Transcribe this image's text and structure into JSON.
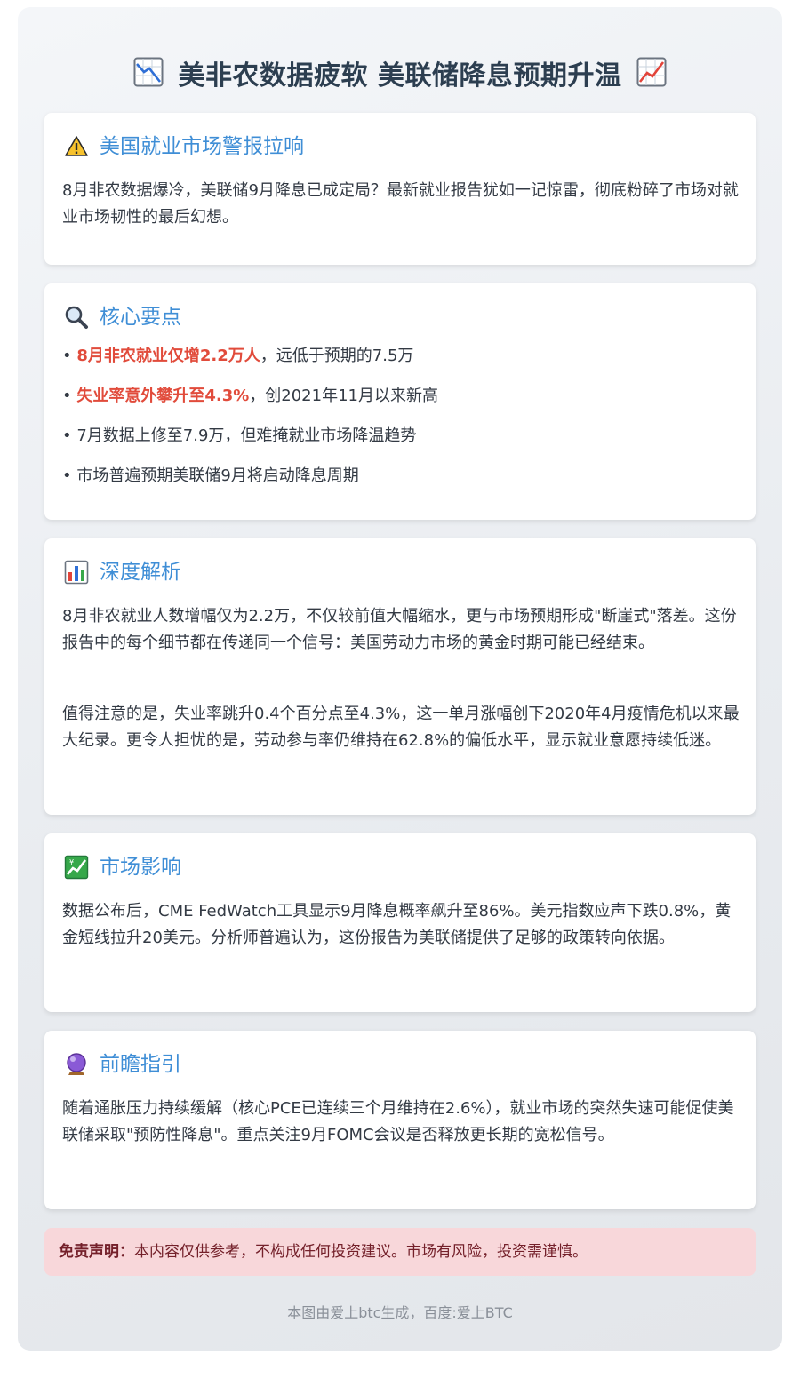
{
  "header": {
    "title": "美非农数据疲软 美联储降息预期升温"
  },
  "sections": [
    {
      "icon": "warning-icon",
      "title": "美国就业市场警报拉响",
      "paragraphs": [
        "8月非农数据爆冷，美联储9月降息已成定局？最新就业报告犹如一记惊雷，彻底粉碎了市场对就业市场韧性的最后幻想。"
      ]
    },
    {
      "icon": "magnifier-icon",
      "title": "核心要点",
      "bullets": [
        {
          "highlight": "8月非农就业仅增2.2万人",
          "rest": "，远低于预期的7.5万"
        },
        {
          "highlight": "失业率意外攀升至4.3%",
          "rest": "，创2021年11月以来新高"
        },
        {
          "highlight": "",
          "rest": "7月数据上修至7.9万，但难掩就业市场降温趋势"
        },
        {
          "highlight": "",
          "rest": "市场普遍预期美联储9月将启动降息周期"
        }
      ]
    },
    {
      "icon": "bar-chart-icon",
      "title": "深度解析",
      "paragraphs": [
        "8月非农就业人数增幅仅为2.2万，不仅较前值大幅缩水，更与市场预期形成\"断崖式\"落差。这份报告中的每个细节都在传递同一个信号：美国劳动力市场的黄金时期可能已经结束。",
        "值得注意的是，失业率跳升0.4个百分点至4.3%，这一单月涨幅创下2020年4月疫情危机以来最大纪录。更令人担忧的是，劳动参与率仍维持在62.8%的偏低水平，显示就业意愿持续低迷。"
      ]
    },
    {
      "icon": "chart-yen-icon",
      "title": "市场影响",
      "paragraphs": [
        "数据公布后，CME FedWatch工具显示9月降息概率飙升至86%。美元指数应声下跌0.8%，黄金短线拉升20美元。分析师普遍认为，这份报告为美联储提供了足够的政策转向依据。"
      ]
    },
    {
      "icon": "crystal-ball-icon",
      "title": "前瞻指引",
      "paragraphs": [
        "随着通胀压力持续缓解（核心PCE已连续三个月维持在2.6%），就业市场的突然失速可能促使美联储采取\"预防性降息\"。重点关注9月FOMC会议是否释放更长期的宽松信号。"
      ]
    }
  ],
  "disclaimer": {
    "label": "免责声明：",
    "text": "本内容仅供参考，不构成任何投资建议。市场有风险，投资需谨慎。"
  },
  "footer": {
    "text": "本图由爱上btc生成，百度:爱上BTC"
  },
  "colors": {
    "accent": "#3f8ed6",
    "highlight": "#e14b3b",
    "title": "#2c3e50",
    "disclaimer_bg": "#f8d7da",
    "disclaimer_text": "#74202a"
  }
}
